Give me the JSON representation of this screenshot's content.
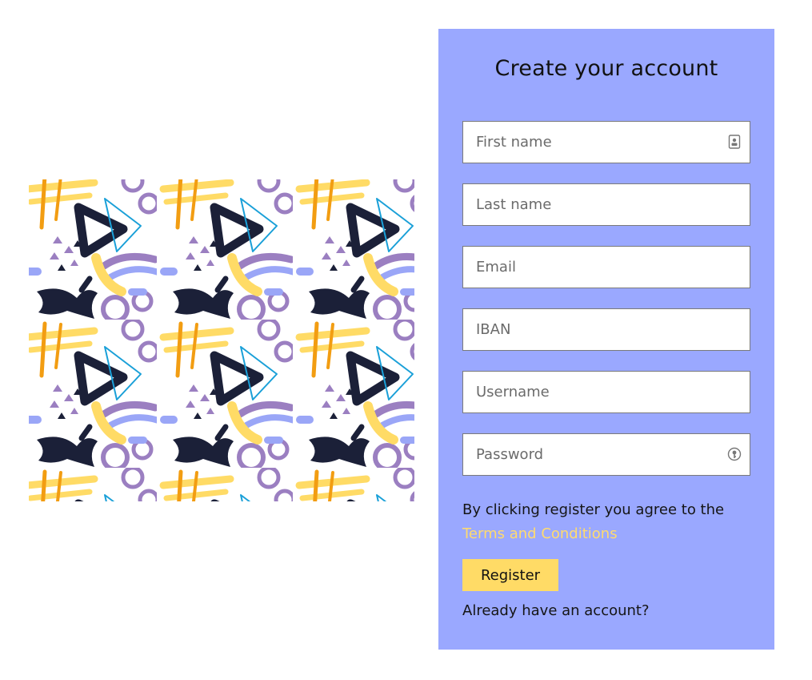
{
  "form": {
    "title": "Create your account",
    "fields": [
      {
        "placeholder": "First name",
        "value": "",
        "icon": "contact-card-icon"
      },
      {
        "placeholder": "Last name",
        "value": ""
      },
      {
        "placeholder": "Email",
        "value": ""
      },
      {
        "placeholder": "IBAN",
        "value": ""
      },
      {
        "placeholder": "Username",
        "value": ""
      },
      {
        "placeholder": "Password",
        "value": "",
        "icon": "password-key-icon"
      }
    ],
    "agree_text": "By clicking register you agree to the",
    "terms_link": "Terms and Conditions",
    "register_label": "Register",
    "login_prompt": "Already have an account?"
  },
  "colors": {
    "card_background": "#9aa8ff",
    "accent_yellow": "#ffdb66",
    "pattern_navy": "#1b2038",
    "pattern_purple": "#9b7fc1",
    "pattern_orange": "#f29d12",
    "pattern_blue": "#1aa0d8",
    "pattern_periwinkle": "#9aa6f7"
  },
  "illustration": {
    "name": "abstract-memphis-pattern"
  }
}
